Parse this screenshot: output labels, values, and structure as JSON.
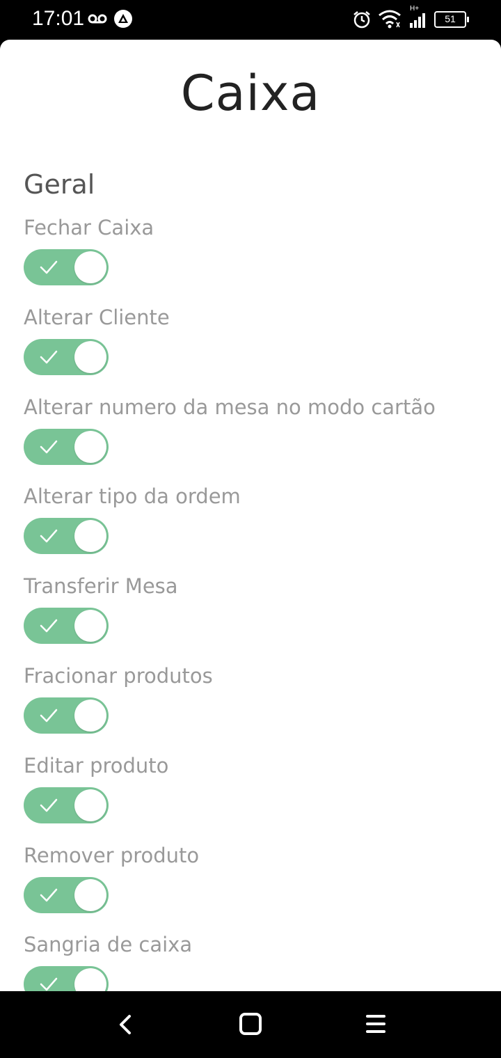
{
  "status_bar": {
    "time": "17:01",
    "battery_level": "51",
    "network_label": "H+",
    "icons": [
      "voicemail-icon",
      "app-notification-icon",
      "alarm-icon",
      "wifi-icon",
      "cell-signal-icon",
      "battery-icon"
    ]
  },
  "page": {
    "title": "Caixa",
    "section": "Geral"
  },
  "settings": [
    {
      "label": "Fechar Caixa",
      "enabled": true
    },
    {
      "label": "Alterar Cliente",
      "enabled": true
    },
    {
      "label": "Alterar numero da mesa no modo cartão",
      "enabled": true
    },
    {
      "label": "Alterar tipo da ordem",
      "enabled": true
    },
    {
      "label": "Transferir Mesa",
      "enabled": true
    },
    {
      "label": "Fracionar produtos",
      "enabled": true
    },
    {
      "label": "Editar produto",
      "enabled": true
    },
    {
      "label": "Remover produto",
      "enabled": true
    },
    {
      "label": "Sangria de caixa",
      "enabled": true
    }
  ],
  "colors": {
    "toggle_on": "#79c496",
    "title": "#222222",
    "label": "#999999"
  },
  "nav_bar": {
    "icons": [
      "back-icon",
      "home-icon",
      "menu-icon"
    ]
  }
}
